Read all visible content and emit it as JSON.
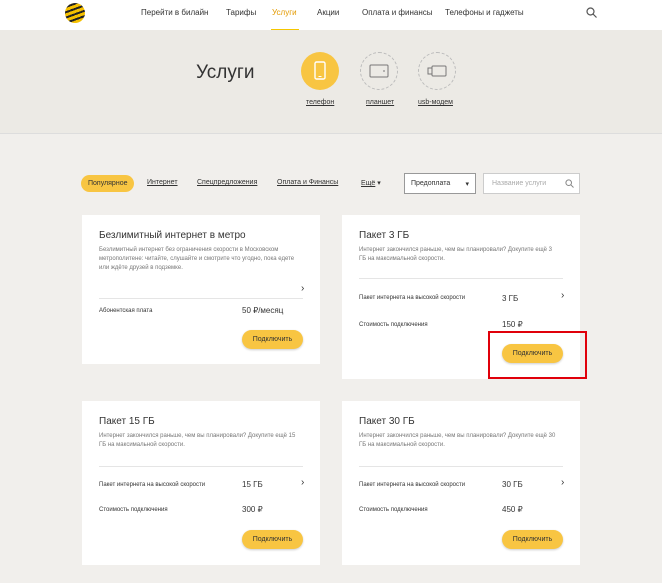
{
  "nav": {
    "items": [
      "Перейти в билайн",
      "Тарифы",
      "Услуги",
      "Акции",
      "Оплата и финансы",
      "Телефоны и гаджеты"
    ],
    "active": "Услуги"
  },
  "hero": {
    "title": "Услуги",
    "devices": [
      "телефон",
      "планшет",
      "usb-модем"
    ]
  },
  "filters": {
    "active": "Популярное",
    "links": [
      "Интернет",
      "Спецпредложения",
      "Оплата и Финансы",
      "Ещё"
    ],
    "select_value": "Предоплата",
    "search_placeholder": "Название услуги"
  },
  "cards": [
    {
      "title": "Безлимитный интернет в метро",
      "desc": "Безлимитный интернет без ограничения скорости в Московском метрополитене: читайте, слушайте и смотрите что угодно, пока едете или ждёте друзей в подземке.",
      "rows": [
        {
          "label": "Абонентская плата",
          "value": "50 ₽/месяц"
        }
      ],
      "button": "Подключить"
    },
    {
      "title": "Пакет 3 ГБ",
      "desc": "Интернет закончился раньше, чем вы планировали? Докупите ещё 3 ГБ на максимальной скорости.",
      "rows": [
        {
          "label": "Пакет интернета на высокой скорости",
          "value": "3 ГБ"
        },
        {
          "label": "Стоимость подключения",
          "value": "150 ₽"
        }
      ],
      "button": "Подключить"
    },
    {
      "title": "Пакет 15 ГБ",
      "desc": "Интернет закончился раньше, чем вы планировали? Докупите ещё 15 ГБ на максимальной скорости.",
      "rows": [
        {
          "label": "Пакет интернета на высокой скорости",
          "value": "15 ГБ"
        },
        {
          "label": "Стоимость подключения",
          "value": "300 ₽"
        }
      ],
      "button": "Подключить"
    },
    {
      "title": "Пакет 30 ГБ",
      "desc": "Интернет закончился раньше, чем вы планировали? Докупите ещё 30 ГБ на максимальной скорости.",
      "rows": [
        {
          "label": "Пакет интернета на высокой скорости",
          "value": "30 ГБ"
        },
        {
          "label": "Стоимость подключения",
          "value": "450 ₽"
        }
      ],
      "button": "Подключить"
    }
  ],
  "colors": {
    "accent": "#f8c542",
    "highlight": "#e0000a"
  }
}
